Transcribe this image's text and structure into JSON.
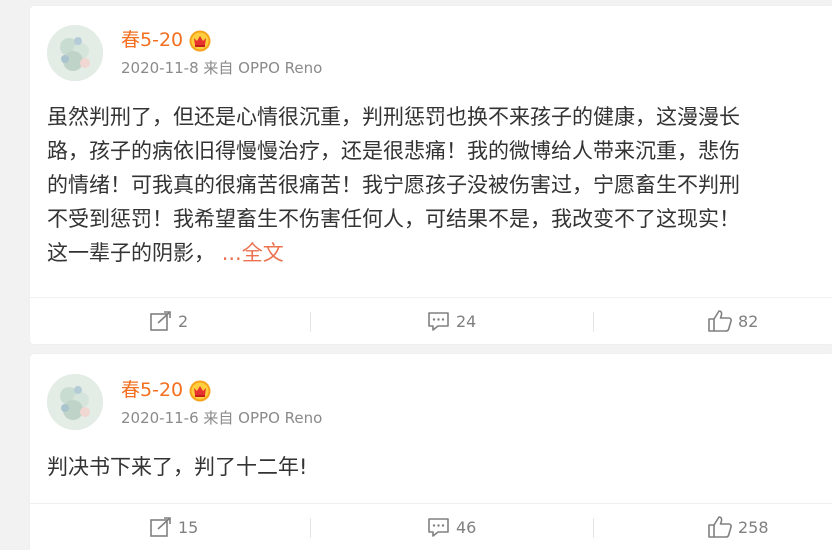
{
  "posts": [
    {
      "username": "春5-20",
      "meta": "2020-11-8 来自 OPPO Reno",
      "content_lines": [
        "虽然判刑了，但还是心情很沉重，判刑惩罚也换不来孩子的健康，这漫漫长",
        "路，孩子的病依旧得慢慢治疗，还是很悲痛！我的微博给人带来沉重，悲伤",
        "的情绪！可我真的很痛苦很痛苦！我宁愿孩子没被伤害过，宁愿畜生不判刑",
        "不受到惩罚！我希望畜生不伤害任何人，可结果不是，我改变不了这现实！",
        "这一辈子的阴影，"
      ],
      "more_link": "...全文",
      "reposts": "2",
      "comments": "24",
      "likes": "82"
    },
    {
      "username": "春5-20",
      "meta": "2020-11-6 来自 OPPO Reno",
      "content_lines": [
        "判决书下来了，判了十二年!"
      ],
      "reposts": "15",
      "comments": "46",
      "likes": "258"
    }
  ],
  "colors": {
    "username": "#f37021",
    "link": "#eb7350",
    "meta": "#8a8a8a",
    "text": "#333333",
    "background": "#f2f2f2"
  },
  "icons": {
    "vip_badge": "crown-badge-icon",
    "repost": "repost-icon",
    "comment": "comment-icon",
    "like": "thumb-up-icon"
  }
}
